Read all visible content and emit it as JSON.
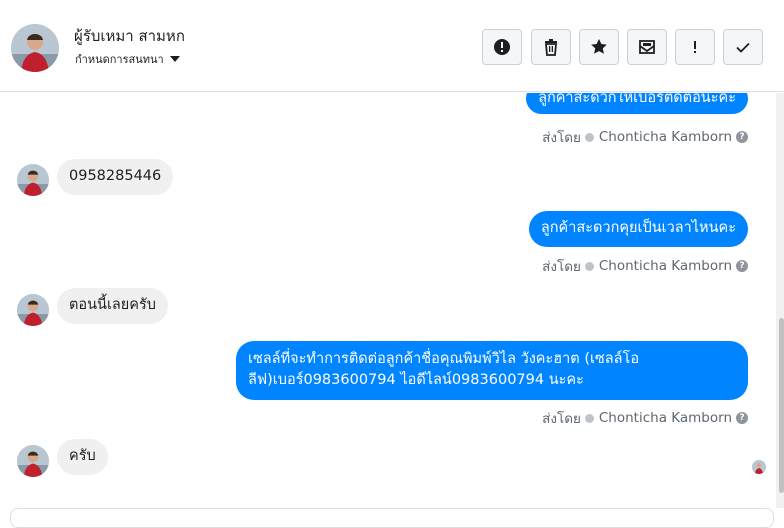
{
  "header": {
    "name": "ผู้รับเหมา สามหก",
    "subtitle": "กำหนดการสนทนา",
    "tools": [
      {
        "icon": "exclamation-circle-icon",
        "label": "Mark as spam"
      },
      {
        "icon": "trash-icon",
        "label": "Delete"
      },
      {
        "icon": "star-icon",
        "label": "Star"
      },
      {
        "icon": "mail-icon",
        "label": "Mark as unread"
      },
      {
        "icon": "exclamation-icon",
        "label": "Follow up"
      },
      {
        "icon": "checkmark-icon",
        "label": "Done"
      }
    ]
  },
  "messages": [
    {
      "dir": "out",
      "text": "ลูกค้าสะดวกให้เบอร์ติดต่อนะคะ",
      "sent_by_prefix": "ส่งโดย",
      "sent_by": "Chonticha Kamborn"
    },
    {
      "dir": "in",
      "text": "0958285446"
    },
    {
      "dir": "out",
      "text": "ลูกค้าสะดวกคุยเป็นเวลาไหนคะ",
      "sent_by_prefix": "ส่งโดย",
      "sent_by": "Chonticha Kamborn"
    },
    {
      "dir": "in",
      "text": "ตอนนี้เลยครับ"
    },
    {
      "dir": "out",
      "line1": "เซลล์ที่จะทำการติดต่อลูกค้าชื่อคุณพิมพ์วิไล วังคะฮาต (เซลล์โอ",
      "line2": "ลีฟ)เบอร์0983600794 ไอดีไลน์0983600794 นะคะ",
      "sent_by_prefix": "ส่งโดย",
      "sent_by": "Chonticha Kamborn"
    },
    {
      "dir": "in",
      "text": "ครับ"
    }
  ],
  "colors": {
    "accent": "#0084ff",
    "incoming": "#f1f0f0"
  }
}
